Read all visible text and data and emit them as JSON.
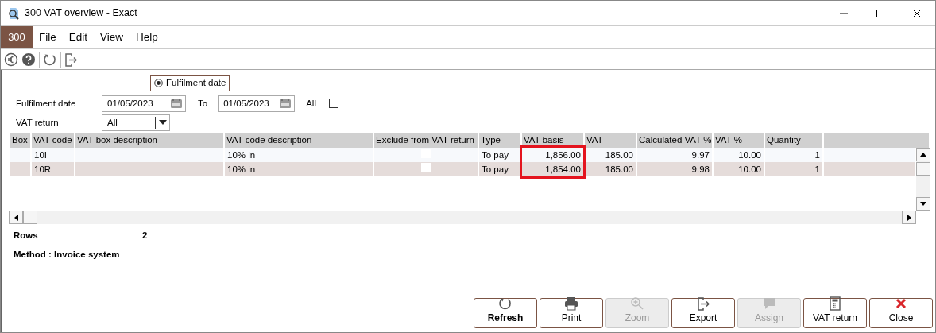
{
  "window": {
    "title": "300 VAT overview - Exact"
  },
  "menu": {
    "company": "300",
    "items": [
      "File",
      "Edit",
      "View",
      "Help"
    ]
  },
  "filter": {
    "date_mode": {
      "label": "Fulfilment date",
      "selected": true
    },
    "date_label": "Fulfilment date",
    "from": "01/05/2023",
    "to_label": "To",
    "to": "01/05/2023",
    "all_label": "All",
    "all_checked": false,
    "vat_return_label": "VAT return",
    "vat_return": "All"
  },
  "table": {
    "columns": [
      {
        "label": "Box",
        "highlighted": false
      },
      {
        "label": "VAT code",
        "highlighted": false
      },
      {
        "label": "VAT box description",
        "highlighted": false
      },
      {
        "label": "VAT code description",
        "highlighted": false
      },
      {
        "label": "Exclude from VAT return",
        "highlighted": false
      },
      {
        "label": "Type",
        "highlighted": false
      },
      {
        "label": "VAT basis",
        "highlighted": true
      },
      {
        "label": "VAT",
        "highlighted": false
      },
      {
        "label": "Calculated VAT %",
        "highlighted": false
      },
      {
        "label": "VAT %",
        "highlighted": false
      },
      {
        "label": "Quantity",
        "highlighted": false
      }
    ],
    "rows": [
      {
        "vat_code": "10I",
        "vat_code_description": "10% in",
        "exclude": false,
        "type": "To pay",
        "vat_basis": "1,856.00",
        "vat": "185.00",
        "calculated_vat_pct": "9.97",
        "vat_pct": "10.00",
        "quantity": "1"
      },
      {
        "vat_code": "10R",
        "vat_code_description": "10% in",
        "exclude": false,
        "type": "To pay",
        "vat_basis": "1,854.00",
        "vat": "185.00",
        "calculated_vat_pct": "9.98",
        "vat_pct": "10.00",
        "quantity": "1"
      }
    ]
  },
  "summary": {
    "rows_label": "Rows",
    "rows_value": "2",
    "method": "Method : Invoice system"
  },
  "buttons": [
    {
      "label": "Refresh",
      "kind": "refresh",
      "disabled": false,
      "default": true
    },
    {
      "label": "Print",
      "kind": "print",
      "disabled": false,
      "default": false
    },
    {
      "label": "Zoom",
      "kind": "zoom",
      "disabled": true,
      "default": false
    },
    {
      "label": "Export",
      "kind": "export",
      "disabled": false,
      "default": false
    },
    {
      "label": "Assign",
      "kind": "assign",
      "disabled": true,
      "default": false
    },
    {
      "label": "VAT return",
      "kind": "vatreturn",
      "disabled": false,
      "default": false
    },
    {
      "label": "Close",
      "kind": "close",
      "disabled": false,
      "default": false
    }
  ]
}
